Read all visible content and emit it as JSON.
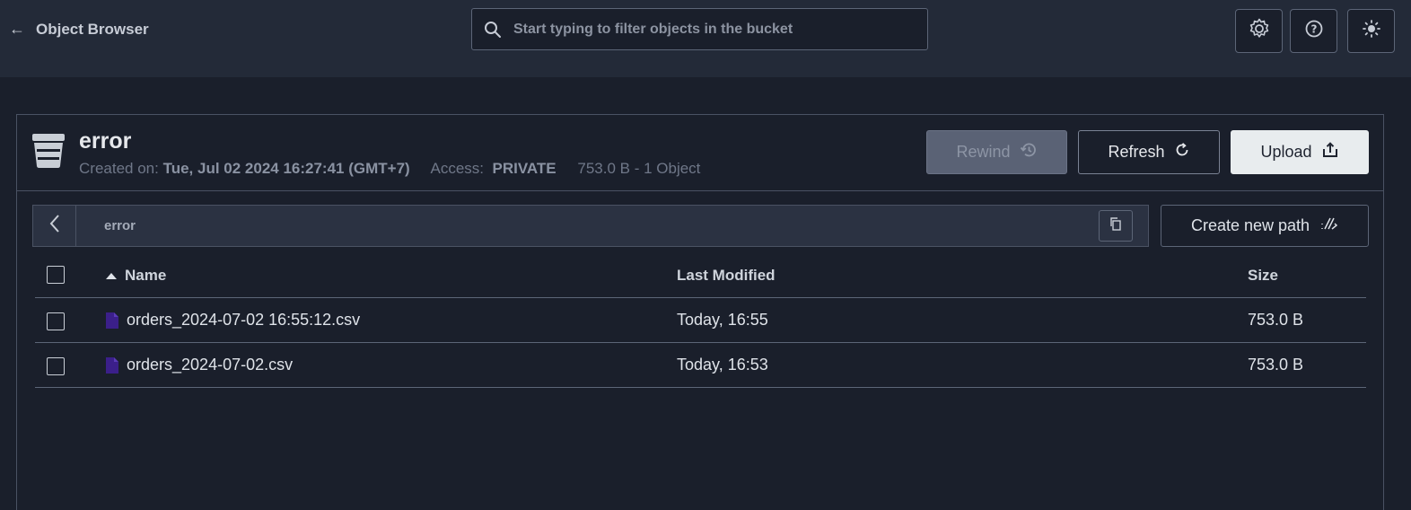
{
  "topbar": {
    "back_icon": "arrow-left-icon",
    "title": "Object Browser",
    "search_placeholder": "Start typing to filter objects in the bucket",
    "icons": [
      "gear-icon",
      "help-circle-icon",
      "sun-icon"
    ]
  },
  "bucket": {
    "name": "error",
    "created_label": "Created on:",
    "created_value": "Tue, Jul 02 2024 16:27:41 (GMT+7)",
    "access_label": "Access:",
    "access_value": "PRIVATE",
    "summary": "753.0 B - 1 Object"
  },
  "actions": {
    "rewind": "Rewind",
    "refresh": "Refresh",
    "upload": "Upload"
  },
  "breadcrumb": {
    "path": "error",
    "create_new_path": "Create new path"
  },
  "table": {
    "headers": {
      "name": "Name",
      "modified": "Last Modified",
      "size": "Size"
    },
    "rows": [
      {
        "name": "orders_2024-07-02 16:55:12.csv",
        "modified": "Today, 16:55",
        "size": "753.0 B"
      },
      {
        "name": "orders_2024-07-02.csv",
        "modified": "Today, 16:53",
        "size": "753.0 B"
      }
    ]
  },
  "colors": {
    "background": "#1a1f2b",
    "topbar": "#232a38",
    "file_icon": "#3b1f8a",
    "upload_button": "#e8ecee"
  }
}
